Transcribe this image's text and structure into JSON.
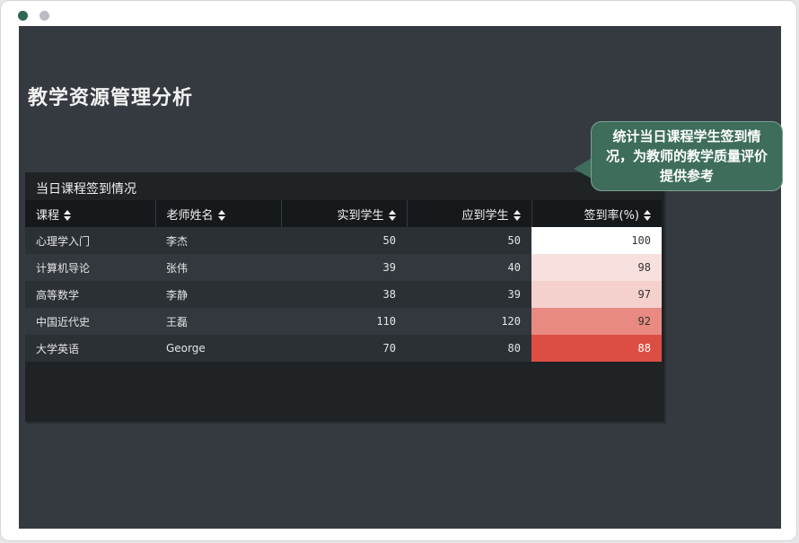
{
  "window": {
    "controls": [
      "close-dot",
      "minimize-dot"
    ]
  },
  "page": {
    "title": "教学资源管理分析"
  },
  "panel": {
    "title": "当日课程签到情况",
    "columns": [
      {
        "label": "课程",
        "sortable": true
      },
      {
        "label": "老师姓名",
        "sortable": true
      },
      {
        "label": "实到学生",
        "sortable": true
      },
      {
        "label": "应到学生",
        "sortable": true
      },
      {
        "label": "签到率(%)",
        "sortable": true
      }
    ],
    "rows": [
      {
        "course": "心理学入门",
        "teacher": "李杰",
        "present": "50",
        "expected": "50",
        "rate": "100",
        "rate_color": "#ffffff",
        "rate_text_color": "#333333"
      },
      {
        "course": "计算机导论",
        "teacher": "张伟",
        "present": "39",
        "expected": "40",
        "rate": "98",
        "rate_color": "#f7e0de",
        "rate_text_color": "#333333"
      },
      {
        "course": "高等数学",
        "teacher": "李静",
        "present": "38",
        "expected": "39",
        "rate": "97",
        "rate_color": "#f5d1ce",
        "rate_text_color": "#333333"
      },
      {
        "course": "中国近代史",
        "teacher": "王磊",
        "present": "110",
        "expected": "120",
        "rate": "92",
        "rate_color": "#e88a82",
        "rate_text_color": "#333333"
      },
      {
        "course": "大学英语",
        "teacher": "George",
        "present": "70",
        "expected": "80",
        "rate": "88",
        "rate_color": "#dc4e43",
        "rate_text_color": "#ffffff"
      }
    ]
  },
  "callout": {
    "text": "统计当日课程学生签到情况，为教师的教学质量评价提供参考"
  },
  "colors": {
    "background": "#353a41",
    "panel": "#1f2326",
    "header": "#16191b",
    "callout": "#3e6e5b",
    "accent_dot": "#2f6657"
  }
}
